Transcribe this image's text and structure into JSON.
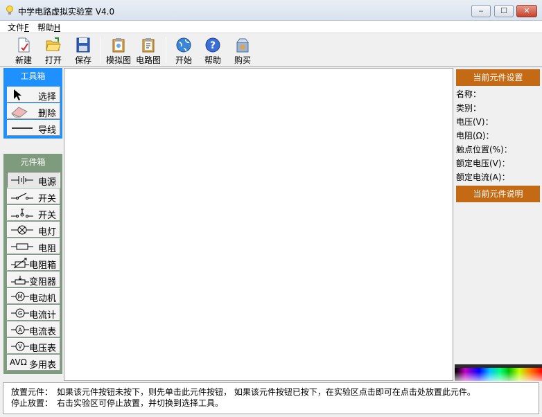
{
  "window": {
    "title": "中学电路虚拟实验室 V4.0",
    "min_label": "‒",
    "max_label": "☐",
    "close_label": "✕"
  },
  "menu": {
    "file": "文件",
    "file_key": "F",
    "help": "帮助",
    "help_key": "H"
  },
  "toolbar": {
    "new": "新建",
    "open": "打开",
    "save": "保存",
    "sim": "模拟图",
    "circuit": "电路图",
    "start": "开始",
    "help": "帮助",
    "buy": "购买"
  },
  "toolbox": {
    "title": "工具箱",
    "select": "选择",
    "delete": "删除",
    "wire": "导线"
  },
  "components": {
    "title": "元件箱",
    "items": [
      "电源",
      "开关",
      "开关",
      "电灯",
      "电阻",
      "电阻箱",
      "变阻器",
      "电动机",
      "电流计",
      "电流表",
      "电压表",
      "多用表"
    ],
    "multimeter_prefix": "AVΩ"
  },
  "right_panel": {
    "settings_title": "当前元件设置",
    "props": [
      "名称：",
      "类别：",
      "电压(V)：",
      "电阻(Ω)：",
      "触点位置(%)：",
      "额定电压(V)：",
      "额定电流(A)："
    ],
    "desc_title": "当前元件说明"
  },
  "status": {
    "place_key": "放置元件：",
    "place_text": "如果该元件按钮未按下，则先单击此元件按钮，  如果该元件按钮已按下，在实验区点击即可在点击处放置此元件。",
    "stop_key": "停止放置：",
    "stop_text": "右击实验区可停止放置，并切换到选择工具。"
  },
  "colors": {
    "toolbox_head": "#1e90ff",
    "component_head": "#7e9b7e",
    "right_head": "#c46a14"
  }
}
